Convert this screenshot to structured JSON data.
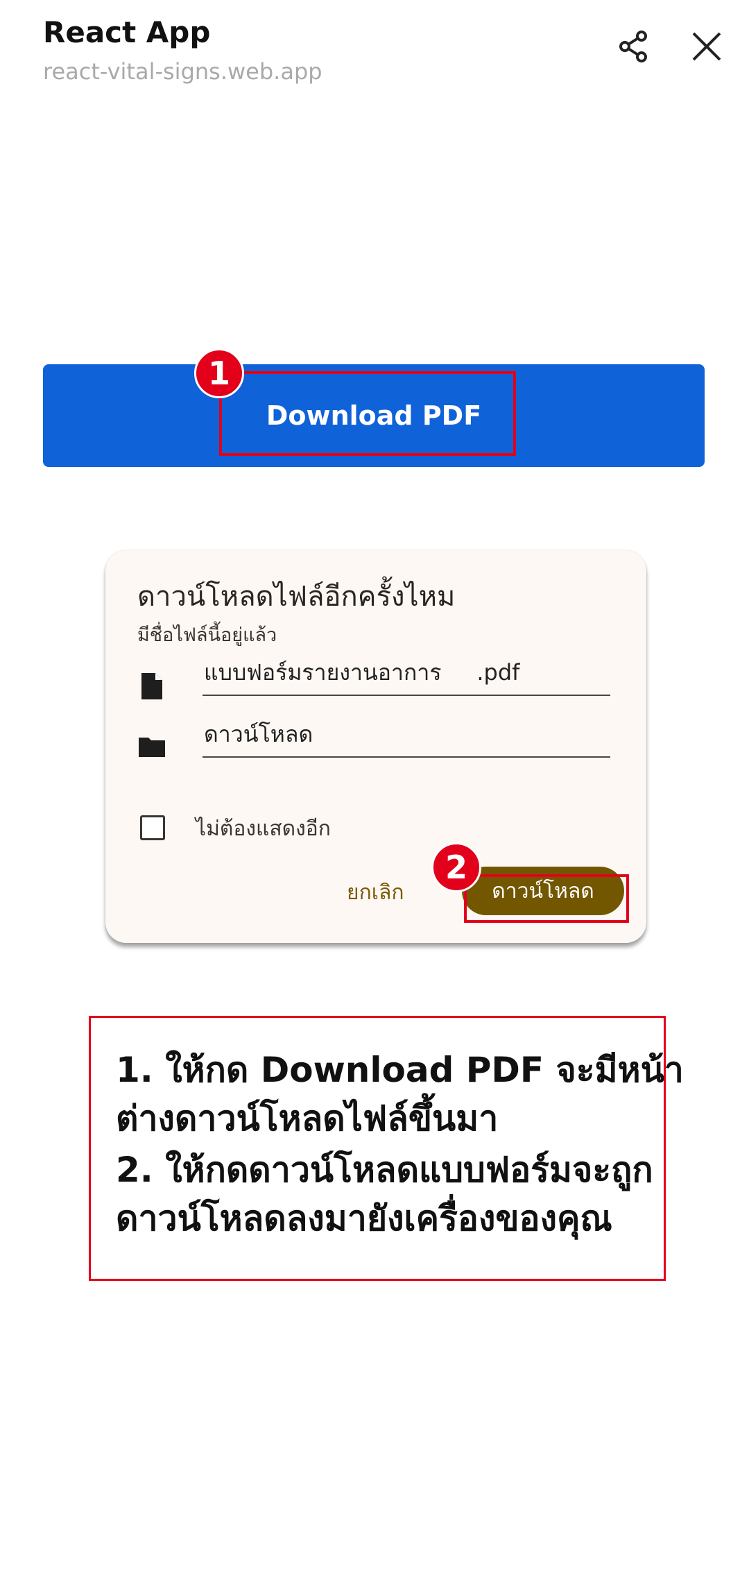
{
  "header": {
    "title": "React App",
    "url": "react-vital-signs.web.app",
    "share_icon": "share-icon",
    "close_icon": "close-icon"
  },
  "main": {
    "download_button_label": "Download PDF",
    "badge_1": "1",
    "badge_2": "2"
  },
  "dialog": {
    "title": "ดาวน์โหลดไฟล์อีกครั้งไหม",
    "subtitle": "มีชื่อไฟล์นี้อยู่แล้ว",
    "filename_value": "แบบฟอร์มรายงานอาการ     .pdf",
    "folder_value": "ดาวน์โหลด",
    "file_icon": "file-icon",
    "folder_icon": "folder-icon",
    "checkbox_label": "ไม่ต้องแสดงอีก",
    "checkbox_checked": false,
    "cancel_label": "ยกเลิก",
    "download_label": "ดาวน์โหลด"
  },
  "instructions": {
    "line1": "1. ให้กด Download PDF จะมีหน้า",
    "line2": "ต่างดาวน์โหลดไฟล์ขึ้นมา",
    "line3": "2. ให้กดดาวน์โหลดแบบฟอร์มจะถูก",
    "line4": "ดาวน์โหลดลงมายังเครื่องของคุณ"
  },
  "colors": {
    "primary_blue": "#0f62d8",
    "dialog_button": "#735600",
    "highlight_red": "#e3001b",
    "dialog_bg": "#fdf8f4"
  }
}
